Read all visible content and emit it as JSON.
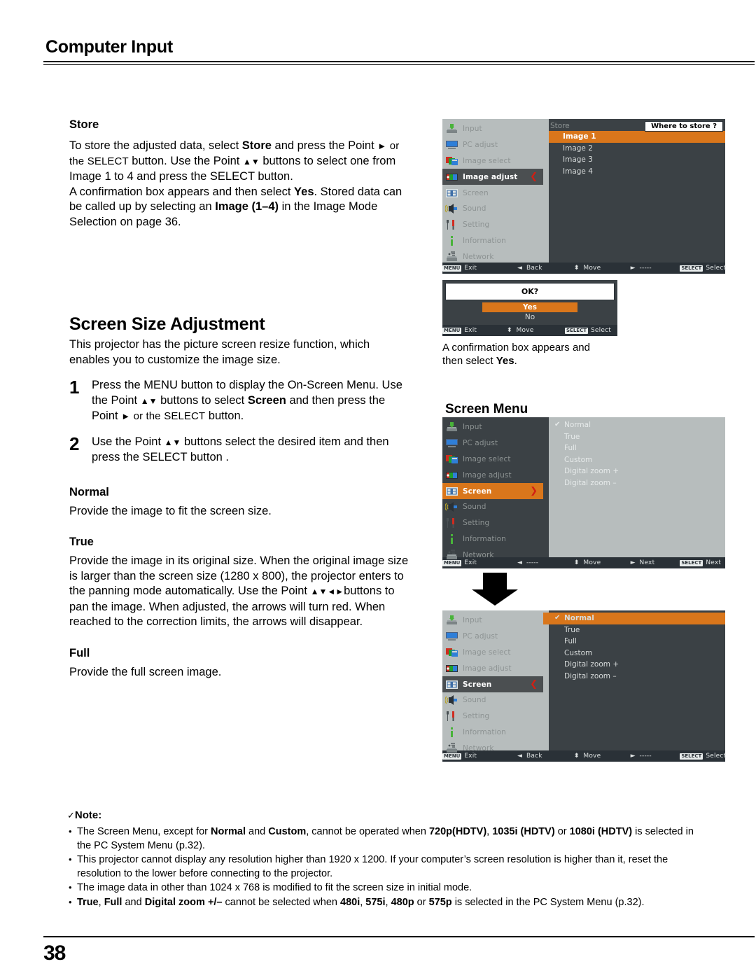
{
  "header": {
    "title": "Computer Input"
  },
  "store_section": {
    "heading": "Store",
    "body_lines": [
      "To store the adjusted data, select ",
      "Store",
      " and press the Point ",
      "►",
      " or the ",
      "SELECT",
      " button. Use the Point ",
      "▲▼",
      " buttons to select one from Image 1 to 4 and press the SELECT button. A confirmation box appears and then select ",
      "Yes",
      ". Stored data can be called up by selecting an ",
      "Image (1–4)",
      " in the Image Mode Selection on page 36."
    ]
  },
  "screen_size_section": {
    "title": "Screen Size Adjustment",
    "intro": "This projector has the picture screen resize function, which enables you to customize the image size.",
    "steps": [
      {
        "num": "1",
        "text_1": "Press the MENU button to display the On-Screen Menu. Use the Point ",
        "arrows": "▲▼",
        "text_2": " buttons to select ",
        "bold": "Screen",
        "text_3": " and then press the Point ",
        "arrow_r": "►",
        "text_4": " or the ",
        "smallcaps": "SELECT",
        "text_5": " button."
      },
      {
        "num": "2",
        "text_1": "Use the Point ",
        "arrows": "▲▼",
        "text_2": " buttons select the desired item and then press the SELECT button ."
      }
    ],
    "terms": [
      {
        "name": "Normal",
        "desc": "Provide the image to fit the screen size."
      },
      {
        "name": "True",
        "desc": "Provide the image in its original size. When the original image size is larger than the screen size (1280 x 800), the projector enters to the panning mode automatically. Use the Point ▲▼◄► buttons to pan the image. When adjusted, the arrows will turn red. When reached to the correction limits, the arrows will disappear."
      },
      {
        "name": "Full",
        "desc": "Provide the full screen image."
      }
    ]
  },
  "osd": {
    "menu_items": [
      {
        "label": "Input",
        "icon": "input-icon"
      },
      {
        "label": "PC adjust",
        "icon": "pc-adjust-icon"
      },
      {
        "label": "Image select",
        "icon": "image-select-icon"
      },
      {
        "label": "Image adjust",
        "icon": "image-adjust-icon"
      },
      {
        "label": "Screen",
        "icon": "screen-icon"
      },
      {
        "label": "Sound",
        "icon": "sound-icon"
      },
      {
        "label": "Setting",
        "icon": "setting-icon"
      },
      {
        "label": "Information",
        "icon": "information-icon"
      },
      {
        "label": "Network",
        "icon": "network-icon"
      }
    ],
    "store_menu": {
      "selected_menu_item": "Image adjust",
      "panel_title": "Store",
      "where_to_store": "Where to store ?",
      "items": [
        "Image 1",
        "Image 2",
        "Image 3",
        "Image 4"
      ],
      "highlighted_item": "Image 1",
      "bottom_bar": [
        {
          "key": "MENU",
          "label": "Exit"
        },
        {
          "key": "◄",
          "label": "Back"
        },
        {
          "key": "⬍",
          "label": "Move"
        },
        {
          "key": "►",
          "label": "-----"
        },
        {
          "key": "SELECT",
          "label": "Select"
        }
      ]
    },
    "confirm_dialog": {
      "question": "OK?",
      "yes": "Yes",
      "no": "No",
      "bottom_bar": [
        {
          "key": "MENU",
          "label": "Exit"
        },
        {
          "key": "⬍",
          "label": "Move"
        },
        {
          "key": "SELECT",
          "label": "Select"
        }
      ],
      "caption_1": "A confirmation box appears and then select ",
      "caption_bold": "Yes",
      "caption_2": "."
    },
    "screen_menu_heading": "Screen Menu",
    "screen_menu_top": {
      "selected_menu_item": "Screen",
      "options": [
        "Normal",
        "True",
        "Full",
        "Custom",
        "Digital zoom +",
        "Digital zoom –"
      ],
      "checked_option": "Normal",
      "bottom_bar": [
        {
          "key": "MENU",
          "label": "Exit"
        },
        {
          "key": "◄",
          "label": "-----"
        },
        {
          "key": "⬍",
          "label": "Move"
        },
        {
          "key": "►",
          "label": "Next"
        },
        {
          "key": "SELECT",
          "label": "Next"
        }
      ]
    },
    "screen_menu_bottom": {
      "selected_menu_item": "Screen",
      "options": [
        "Normal",
        "True",
        "Full",
        "Custom",
        "Digital zoom +",
        "Digital zoom –"
      ],
      "checked_option": "Normal",
      "highlighted_option": "Normal",
      "bottom_bar": [
        {
          "key": "MENU",
          "label": "Exit"
        },
        {
          "key": "◄",
          "label": "Back"
        },
        {
          "key": "⬍",
          "label": "Move"
        },
        {
          "key": "►",
          "label": "-----"
        },
        {
          "key": "SELECT",
          "label": "Select"
        }
      ]
    },
    "colors": {
      "highlight_orange": "#d9761b",
      "panel_dark": "#3b4145",
      "panel_light": "#b7bdbd",
      "bar_dark": "#2a3137",
      "arrow_red": "#d21f13"
    }
  },
  "note": {
    "title": "Note:",
    "tick": "✓",
    "items": [
      {
        "parts": [
          {
            "t": "The Screen Menu, except for ",
            "b": false
          },
          {
            "t": "Normal",
            "b": true
          },
          {
            "t": " and ",
            "b": false
          },
          {
            "t": "Custom",
            "b": true
          },
          {
            "t": ", cannot be operated when ",
            "b": false
          },
          {
            "t": "720p(HDTV)",
            "b": true
          },
          {
            "t": ", ",
            "b": false
          },
          {
            "t": "1035i (HDTV)",
            "b": true
          },
          {
            "t": " or ",
            "b": false
          },
          {
            "t": "1080i (HDTV)",
            "b": true
          },
          {
            "t": "  is selected in the PC System Menu (p.32).",
            "b": false
          }
        ]
      },
      {
        "parts": [
          {
            "t": "This projector cannot display any resolution higher than 1920 x 1200. If your computer’s screen resolution is higher than it, reset the resolution to the lower before connecting to the projector.",
            "b": false
          }
        ]
      },
      {
        "parts": [
          {
            "t": "The image data in other than 1024 x 768 is modified to fit the screen size in initial mode.",
            "b": false
          }
        ]
      },
      {
        "parts": [
          {
            "t": "True",
            "b": true
          },
          {
            "t": ", ",
            "b": false
          },
          {
            "t": "Full",
            "b": true
          },
          {
            "t": " and ",
            "b": false
          },
          {
            "t": "Digital zoom +/–",
            "b": true
          },
          {
            "t": " cannot be selected when ",
            "b": false
          },
          {
            "t": "480i",
            "b": true
          },
          {
            "t": ", ",
            "b": false
          },
          {
            "t": "575i",
            "b": true
          },
          {
            "t": ", ",
            "b": false
          },
          {
            "t": "480p",
            "b": true
          },
          {
            "t": " or ",
            "b": false
          },
          {
            "t": "575p",
            "b": true
          },
          {
            "t": " is selected in the PC System Menu (p.32).",
            "b": false
          }
        ]
      }
    ]
  },
  "footer": {
    "page_number": "38"
  }
}
